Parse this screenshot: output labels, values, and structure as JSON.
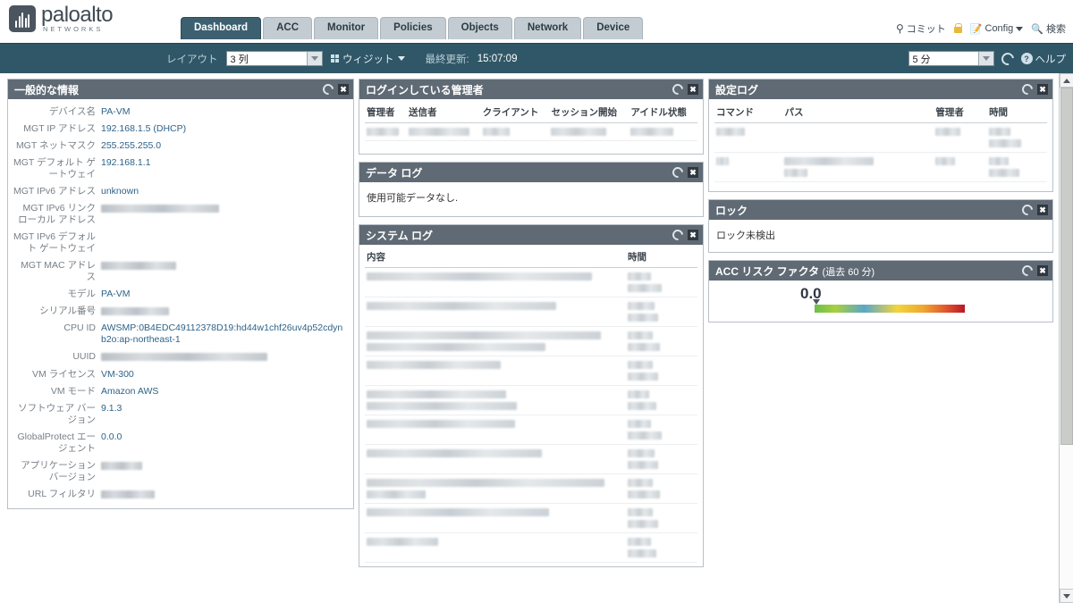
{
  "brand": {
    "name": "paloalto",
    "tagline": "NETWORKS",
    "logo_icon": "paloalto-logo-icon"
  },
  "nav": {
    "tabs": [
      {
        "label": "Dashboard",
        "active": true
      },
      {
        "label": "ACC",
        "active": false
      },
      {
        "label": "Monitor",
        "active": false
      },
      {
        "label": "Policies",
        "active": false
      },
      {
        "label": "Objects",
        "active": false
      },
      {
        "label": "Network",
        "active": false
      },
      {
        "label": "Device",
        "active": false
      }
    ]
  },
  "topright": {
    "commit_label": "コミット",
    "commit_icon": "commit-icon",
    "lock_icon": "lock-icon",
    "config_label": "Config",
    "config_icon": "config-icon",
    "search_label": "検索",
    "search_icon": "search-icon"
  },
  "toolbar": {
    "layout_label": "レイアウト",
    "layout_value": "3 列",
    "widget_label": "ウィジット",
    "widget_icon": "grid-icon",
    "last_updated_label": "最終更新:",
    "last_updated_value": "15:07:09",
    "interval_value": "5 分",
    "refresh_icon": "refresh-icon",
    "help_label": "ヘルプ",
    "help_icon": "help-icon"
  },
  "widgets": {
    "general_info": {
      "title": "一般的な情報",
      "refresh_icon": "refresh-icon",
      "close_icon": "close-icon",
      "rows": [
        {
          "key": "デバイス名",
          "value": "PA-VM",
          "redacted": false
        },
        {
          "key": "MGT IP アドレス",
          "value": "192.168.1.5 (DHCP)",
          "redacted": false
        },
        {
          "key": "MGT ネットマスク",
          "value": "255.255.255.0",
          "redacted": false
        },
        {
          "key": "MGT デフォルト ゲートウェイ",
          "value": "192.168.1.1",
          "redacted": false
        },
        {
          "key": "MGT IPv6 アドレス",
          "value": "unknown",
          "redacted": false
        },
        {
          "key": "MGT IPv6 リンク ローカル アドレス",
          "value": "",
          "redacted": true,
          "redact_width": 132
        },
        {
          "key": "MGT IPv6 デフォルト ゲートウェイ",
          "value": "",
          "redacted": false
        },
        {
          "key": "MGT MAC アドレス",
          "value": "",
          "redacted": true,
          "redact_width": 84
        },
        {
          "key": "モデル",
          "value": "PA-VM",
          "redacted": false
        },
        {
          "key": "シリアル番号",
          "value": "",
          "redacted": true,
          "redact_width": 76
        },
        {
          "key": "CPU ID",
          "value": "AWSMP:0B4EDC49112378D19:hd44w1chf26uv4p52cdynb2o:ap-northeast-1",
          "redacted": false
        },
        {
          "key": "UUID",
          "value": "",
          "redacted": true,
          "redact_width": 186
        },
        {
          "key": "VM ライセンス",
          "value": "VM-300",
          "redacted": false
        },
        {
          "key": "VM モード",
          "value": "Amazon AWS",
          "redacted": false
        },
        {
          "key": "ソフトウェア バージョン",
          "value": "9.1.3",
          "redacted": false
        },
        {
          "key": "GlobalProtect エージェント",
          "value": "0.0.0",
          "redacted": false
        },
        {
          "key": "アプリケーション バージョン",
          "value": "",
          "redacted": true,
          "redact_width": 46
        },
        {
          "key": "URL フィルタリ",
          "value": "",
          "redacted": true,
          "redact_width": 60
        }
      ]
    },
    "logged_in_admins": {
      "title": "ログインしている管理者",
      "refresh_icon": "refresh-icon",
      "close_icon": "close-icon",
      "columns": [
        "管理者",
        "送信者",
        "クライアント",
        "セッション開始",
        "アイドル状態"
      ],
      "rows": [
        {
          "redacted": true,
          "widths": [
            36,
            68,
            30,
            62,
            48
          ]
        }
      ]
    },
    "data_log": {
      "title": "データ ログ",
      "refresh_icon": "refresh-icon",
      "close_icon": "close-icon",
      "message": "使用可能データなし."
    },
    "system_log": {
      "title": "システム ログ",
      "refresh_icon": "refresh-icon",
      "close_icon": "close-icon",
      "columns": [
        "内容",
        "時間"
      ],
      "rows": [
        {
          "redacted": true,
          "content_widths": [
            252
          ],
          "time_widths": [
            26,
            38
          ]
        },
        {
          "redacted": true,
          "content_widths": [
            212
          ],
          "time_widths": [
            30,
            34
          ]
        },
        {
          "redacted": true,
          "content_widths": [
            262,
            200
          ],
          "time_widths": [
            28,
            36
          ]
        },
        {
          "redacted": true,
          "content_widths": [
            150
          ],
          "time_widths": [
            28,
            34
          ]
        },
        {
          "redacted": true,
          "content_widths": [
            156,
            168
          ],
          "time_widths": [
            24,
            32
          ]
        },
        {
          "redacted": true,
          "content_widths": [
            166
          ],
          "time_widths": [
            26,
            38
          ]
        },
        {
          "redacted": true,
          "content_widths": [
            196
          ],
          "time_widths": [
            30,
            34
          ]
        },
        {
          "redacted": true,
          "content_widths": [
            266,
            66
          ],
          "time_widths": [
            28,
            36
          ]
        },
        {
          "redacted": true,
          "content_widths": [
            204
          ],
          "time_widths": [
            28,
            34
          ]
        },
        {
          "redacted": true,
          "content_widths": [
            80
          ],
          "time_widths": [
            26,
            32
          ]
        }
      ]
    },
    "config_log": {
      "title": "設定ログ",
      "refresh_icon": "refresh-icon",
      "close_icon": "close-icon",
      "columns": [
        "コマンド",
        "パス",
        "管理者",
        "時間"
      ],
      "rows": [
        {
          "redacted": true,
          "widths": [
            32,
            0,
            28,
            24
          ],
          "time_second_width": 36,
          "path_second_width": 0
        },
        {
          "redacted": true,
          "widths": [
            14,
            100,
            22,
            22
          ],
          "time_second_width": 34,
          "path_second_width": 26
        }
      ]
    },
    "lock": {
      "title": "ロック",
      "refresh_icon": "refresh-icon",
      "close_icon": "close-icon",
      "message": "ロック未検出"
    },
    "acc_risk": {
      "title": "ACC リスク ファクタ",
      "title_suffix": "(過去 60 分)",
      "refresh_icon": "refresh-icon",
      "close_icon": "close-icon",
      "value": "0.0"
    }
  },
  "scrollbar": {
    "up_icon": "scroll-up-icon",
    "down_icon": "scroll-down-icon",
    "thumb": "scroll-thumb"
  },
  "colors": {
    "brand_dark": "#3f4a54",
    "toolbar_bg": "#305767",
    "tab_active": "#3d6070",
    "widget_header": "#5f6a74",
    "value_text": "#2e6389"
  }
}
